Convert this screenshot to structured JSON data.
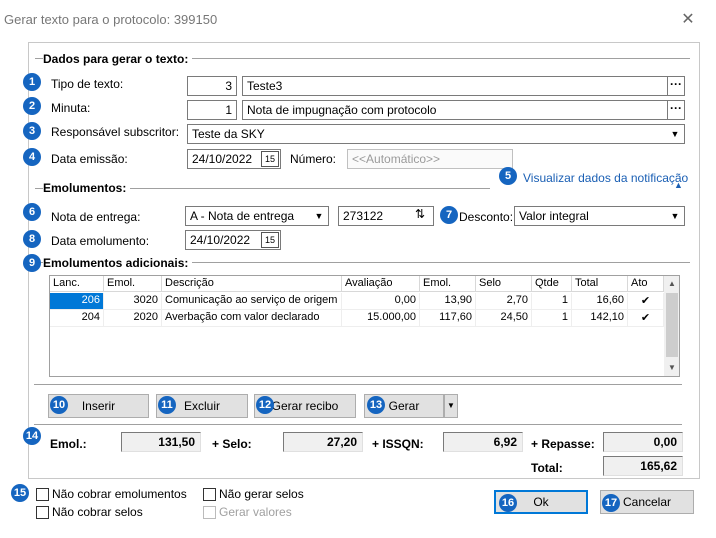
{
  "window": {
    "title": "Gerar texto para o protocolo: 399150",
    "close_glyph": "✕"
  },
  "sections": {
    "dados": "Dados para gerar o texto:",
    "emolumentos": "Emolumentos:",
    "adicionais": "Emolumentos adicionais:"
  },
  "badges": [
    "1",
    "2",
    "3",
    "4",
    "5",
    "6",
    "7",
    "8",
    "9",
    "10",
    "11",
    "12",
    "13",
    "14",
    "15",
    "16",
    "17"
  ],
  "tipo_texto": {
    "label": "Tipo de texto:",
    "code": "3",
    "value": "Teste3"
  },
  "minuta": {
    "label": "Minuta:",
    "code": "1",
    "value": "Nota de impugnação com protocolo"
  },
  "responsavel": {
    "label": "Responsável subscritor:",
    "value": "Teste da SKY"
  },
  "data_emissao": {
    "label": "Data emissão:",
    "value": "24/10/2022"
  },
  "numero": {
    "label": "Número:",
    "placeholder": "<<Automático>>"
  },
  "visualizar_link": "Visualizar dados da notificação",
  "nota_entrega": {
    "label": "Nota de entrega:",
    "value": "A  - Nota de entrega",
    "number": "273122"
  },
  "desconto": {
    "label": "Desconto:",
    "value": "Valor integral"
  },
  "data_emolumento": {
    "label": "Data emolumento:",
    "value": "24/10/2022"
  },
  "grid": {
    "headers": [
      "Lanc.",
      "Emol.",
      "Descrição",
      "Avaliação",
      "Emol.",
      "Selo",
      "Qtde",
      "Total",
      "Ato"
    ],
    "rows": [
      {
        "lanc": "206",
        "emol": "3020",
        "descricao": "Comunicação ao serviço de origem",
        "avaliacao": "0,00",
        "emol2": "13,90",
        "selo": "2,70",
        "qtde": "1",
        "total": "16,60",
        "ato": "✔"
      },
      {
        "lanc": "204",
        "emol": "2020",
        "descricao": "Averbação com valor declarado",
        "avaliacao": "15.000,00",
        "emol2": "117,60",
        "selo": "24,50",
        "qtde": "1",
        "total": "142,10",
        "ato": "✔"
      }
    ]
  },
  "buttons": {
    "inserir": "Inserir",
    "excluir": "Excluir",
    "gerar_recibo": "Gerar recibo",
    "gerar": "Gerar",
    "ok": "Ok",
    "cancelar": "Cancelar"
  },
  "totais": {
    "emol_label": "Emol.:",
    "emol": "131,50",
    "selo_label": "+ Selo:",
    "selo": "27,20",
    "issqn_label": "+ ISSQN:",
    "issqn": "6,92",
    "repasse_label": "+ Repasse:",
    "repasse": "0,00",
    "total_label": "Total:",
    "total": "165,62"
  },
  "checkboxes": {
    "nao_cobrar_emolumentos": "Não cobrar emolumentos",
    "nao_cobrar_selos": "Não cobrar selos",
    "nao_gerar_selos": "Não gerar selos",
    "gerar_valores": "Gerar valores"
  },
  "colors": {
    "badge": "#1565c0",
    "link": "#1a5fb4",
    "selection": "#0078d7"
  }
}
